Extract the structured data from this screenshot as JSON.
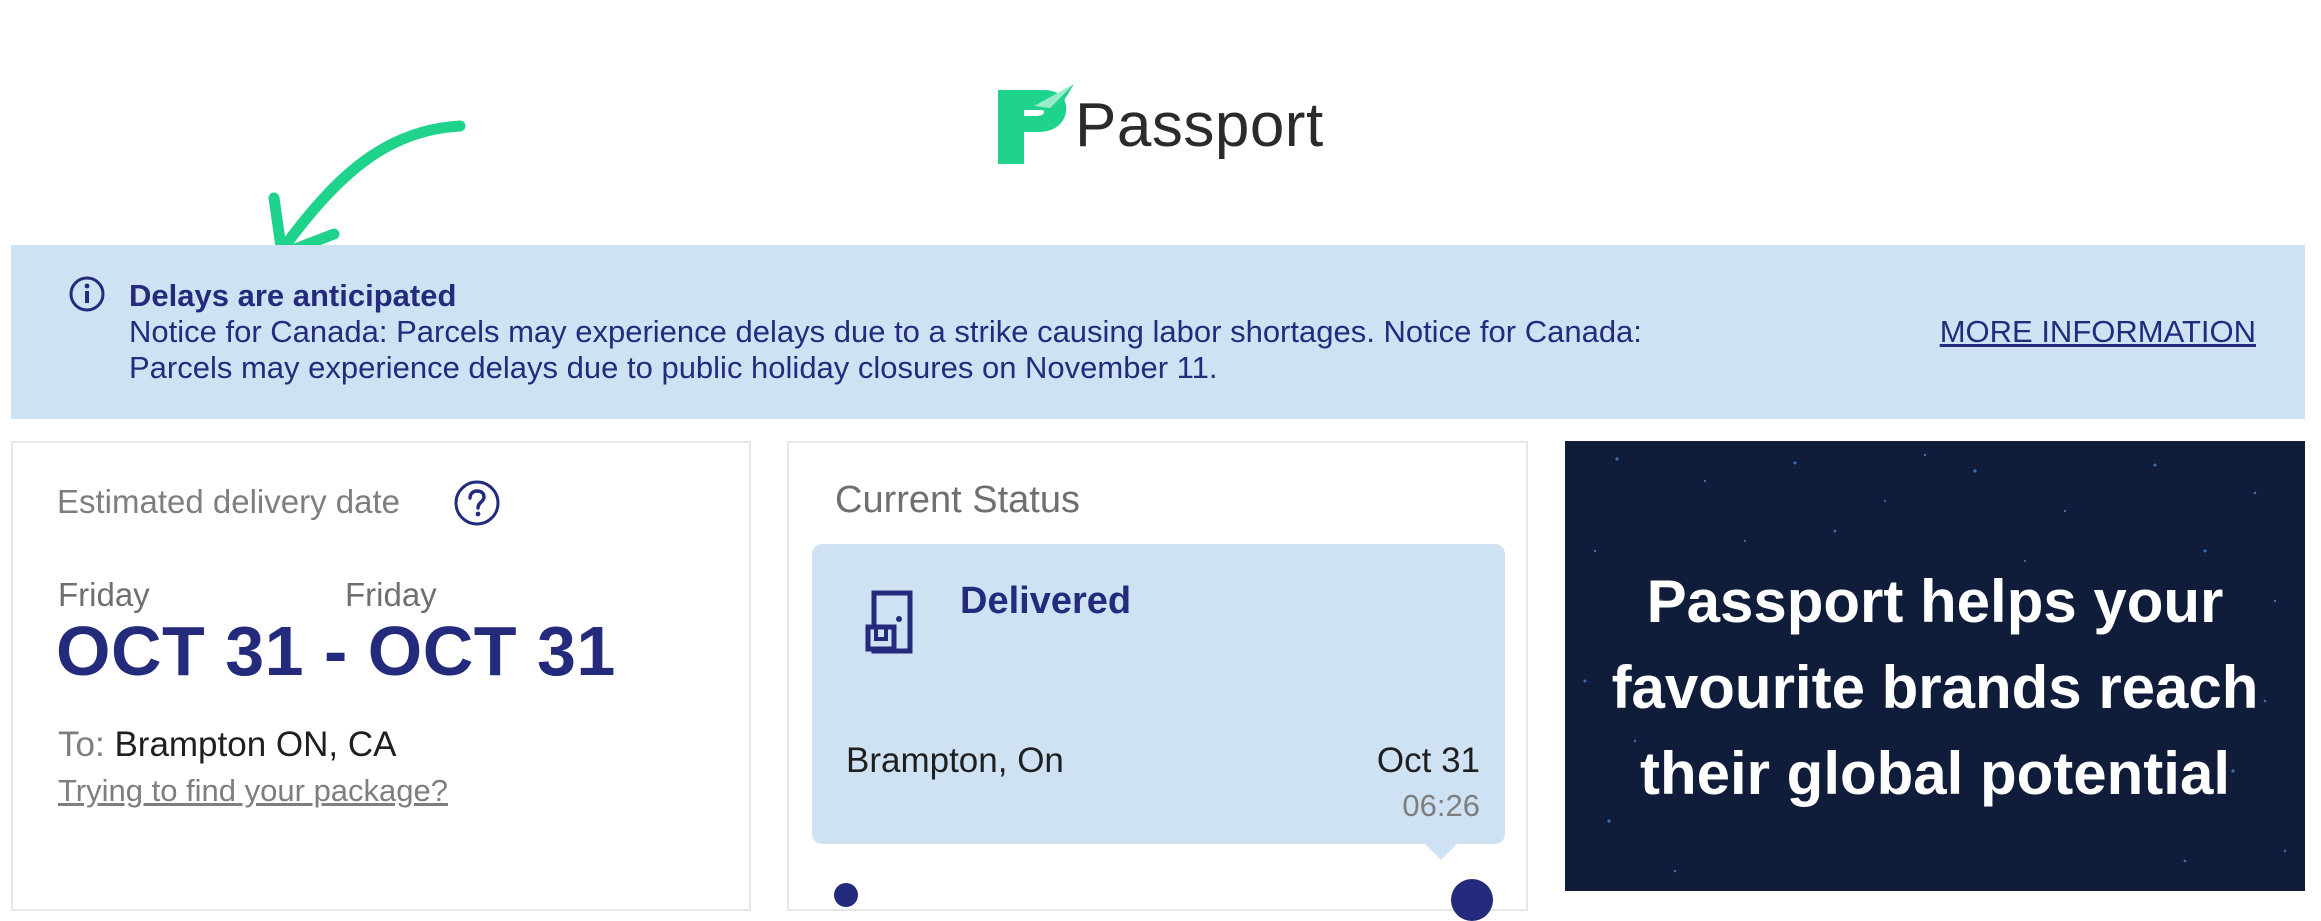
{
  "brand": {
    "name": "Passport",
    "accent_color": "#1fd38c",
    "primary_color": "#242a7c"
  },
  "alert": {
    "icon": "info-circle-icon",
    "title": "Delays are anticipated",
    "body": "Notice for Canada: Parcels may experience delays due to a strike causing labor shortages. Notice for Canada: Parcels may experience delays due to public holiday closures on November 11.",
    "link_label": "MORE INFORMATION"
  },
  "estimated_delivery": {
    "label": "Estimated delivery date",
    "help_icon": "question-circle-icon",
    "start_day": "Friday",
    "end_day": "Friday",
    "range": "OCT 31 - OCT 31",
    "to_label": "To:",
    "destination": "Brampton ON, CA",
    "find_link": "Trying to find your package?"
  },
  "current_status": {
    "title": "Current Status",
    "icon": "door-package-icon",
    "status": "Delivered",
    "location": "Brampton, On",
    "date": "Oct 31",
    "time": "06:26"
  },
  "promo": {
    "text": "Passport helps your favourite brands reach their global potential"
  }
}
